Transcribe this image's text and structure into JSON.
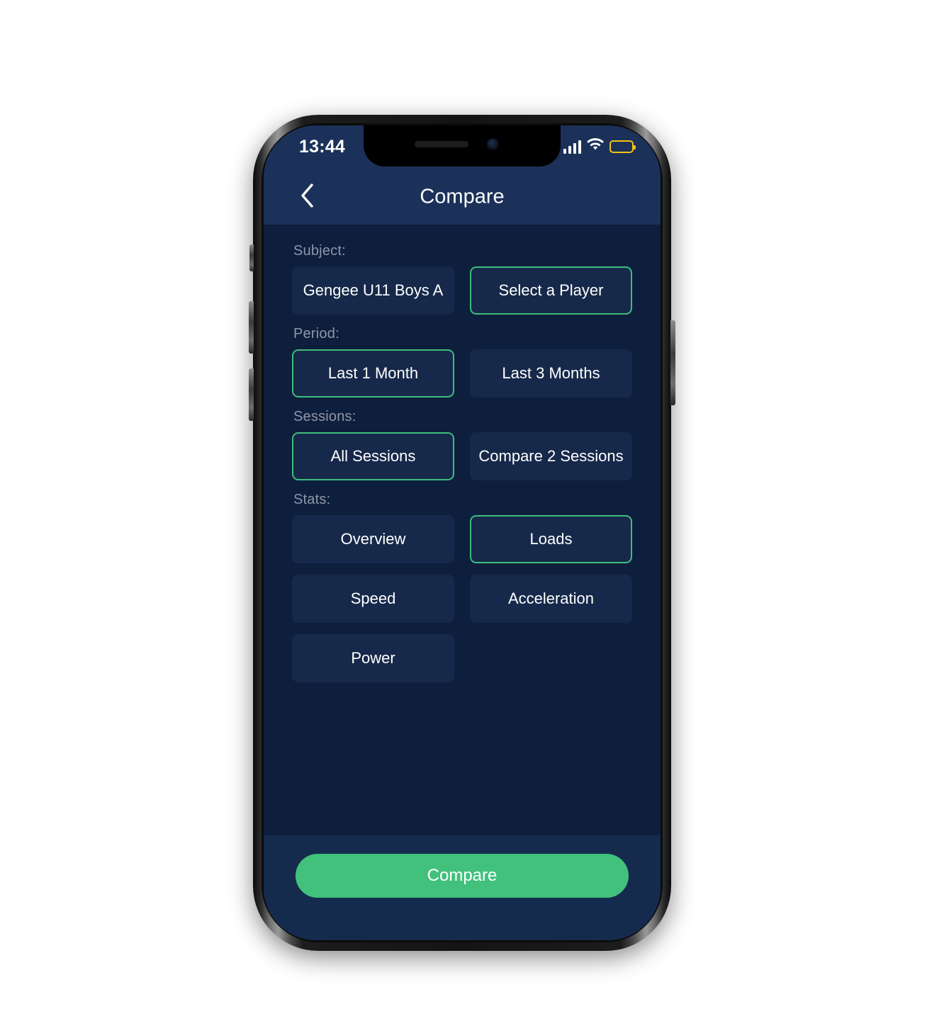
{
  "status_bar": {
    "time": "13:44",
    "signal_icon": "cellular-signal-icon",
    "wifi_icon": "wifi-icon",
    "battery_icon": "battery-icon",
    "battery_color": "#f2c314"
  },
  "header": {
    "back_icon": "chevron-left-icon",
    "title": "Compare"
  },
  "theme": {
    "background": "#0e1f3d",
    "surface": "#16294a",
    "header_bar": "#1b3159",
    "accent_green": "#41c17c",
    "selected_border": "#3dbd79",
    "label_gray": "#8e96a8"
  },
  "sections": [
    {
      "label": "Subject:",
      "options": [
        {
          "label": "Gengee U11 Boys A",
          "selected": false
        },
        {
          "label": "Select a Player",
          "selected": true
        }
      ]
    },
    {
      "label": "Period:",
      "options": [
        {
          "label": "Last 1 Month",
          "selected": true
        },
        {
          "label": "Last 3 Months",
          "selected": false
        }
      ]
    },
    {
      "label": "Sessions:",
      "options": [
        {
          "label": "All Sessions",
          "selected": true
        },
        {
          "label": "Compare 2 Sessions",
          "selected": false
        }
      ]
    },
    {
      "label": "Stats:",
      "options": [
        {
          "label": "Overview",
          "selected": false
        },
        {
          "label": "Loads",
          "selected": true
        },
        {
          "label": "Speed",
          "selected": false
        },
        {
          "label": "Acceleration",
          "selected": false
        },
        {
          "label": "Power",
          "selected": false
        }
      ]
    }
  ],
  "footer": {
    "compare_label": "Compare"
  }
}
